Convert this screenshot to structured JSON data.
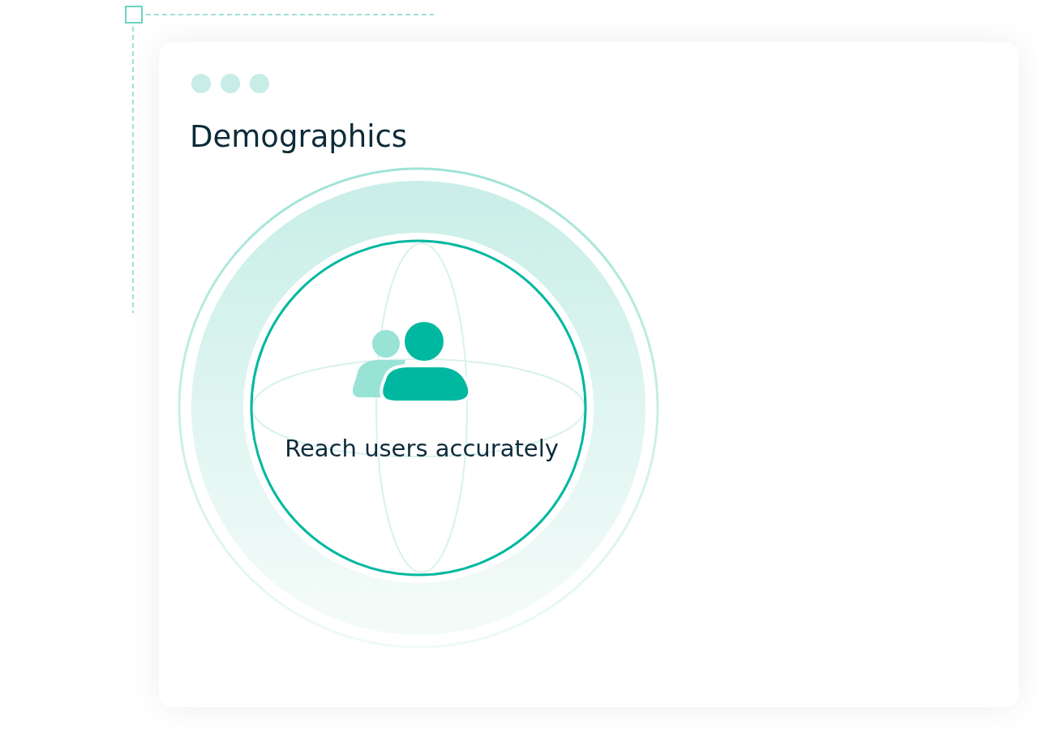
{
  "card": {
    "title": "Demographics",
    "caption": "Reach users accurately"
  }
}
